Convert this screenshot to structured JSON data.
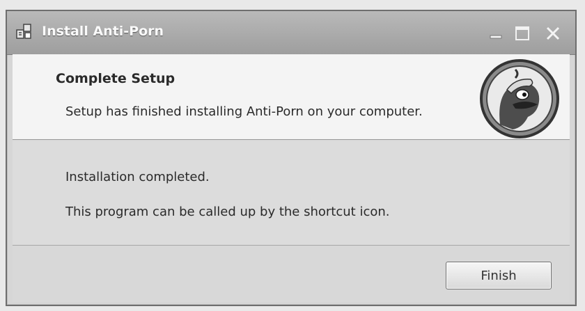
{
  "window": {
    "title": "Install Anti-Porn",
    "icons": {
      "app": "installer-icon",
      "minimize": "minimize-icon",
      "maximize": "maximize-icon",
      "close": "close-icon"
    }
  },
  "header": {
    "title": "Complete Setup",
    "subtitle": "Setup has finished installing Anti-Porn on your computer.",
    "logo": "mascot-logo-icon"
  },
  "body": {
    "line1": "Installation completed.",
    "line2": "This program can be called up by the shortcut icon."
  },
  "footer": {
    "finish_label": "Finish"
  },
  "colors": {
    "titlebar": "#a9a9a9",
    "header_bg": "#f4f4f4",
    "body_bg": "#dcdcdc"
  }
}
